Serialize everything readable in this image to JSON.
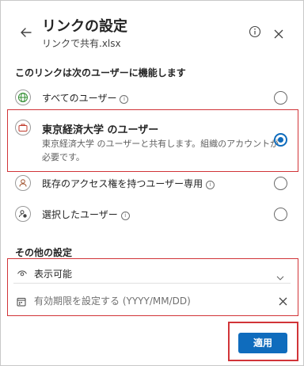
{
  "header": {
    "title": "リンクの設定",
    "subtitle": "リンクで共有.xlsx"
  },
  "section1": {
    "heading": "このリンクは次のユーザーに機能します"
  },
  "options": [
    {
      "label": "すべてのユーザー",
      "info": "i",
      "selected": false
    },
    {
      "label": "東京経済大学 のユーザー",
      "description_line1": "東京経済大学 のユーザーと共有します。組織のアカウントが",
      "description_line2": "必要です。",
      "selected": true
    },
    {
      "label": "既存のアクセス権を持つユーザー専用",
      "info": "i",
      "selected": false
    },
    {
      "label": "選択したユーザー",
      "info": "i",
      "selected": false
    }
  ],
  "section2": {
    "heading": "その他の設定"
  },
  "permission": {
    "value": "表示可能"
  },
  "expiry": {
    "placeholder": "有効期限を設定する (YYYY/MM/DD)"
  },
  "footer": {
    "apply_label": "適用"
  },
  "colors": {
    "accent": "#0f6cbd",
    "highlight": "#d13438"
  }
}
